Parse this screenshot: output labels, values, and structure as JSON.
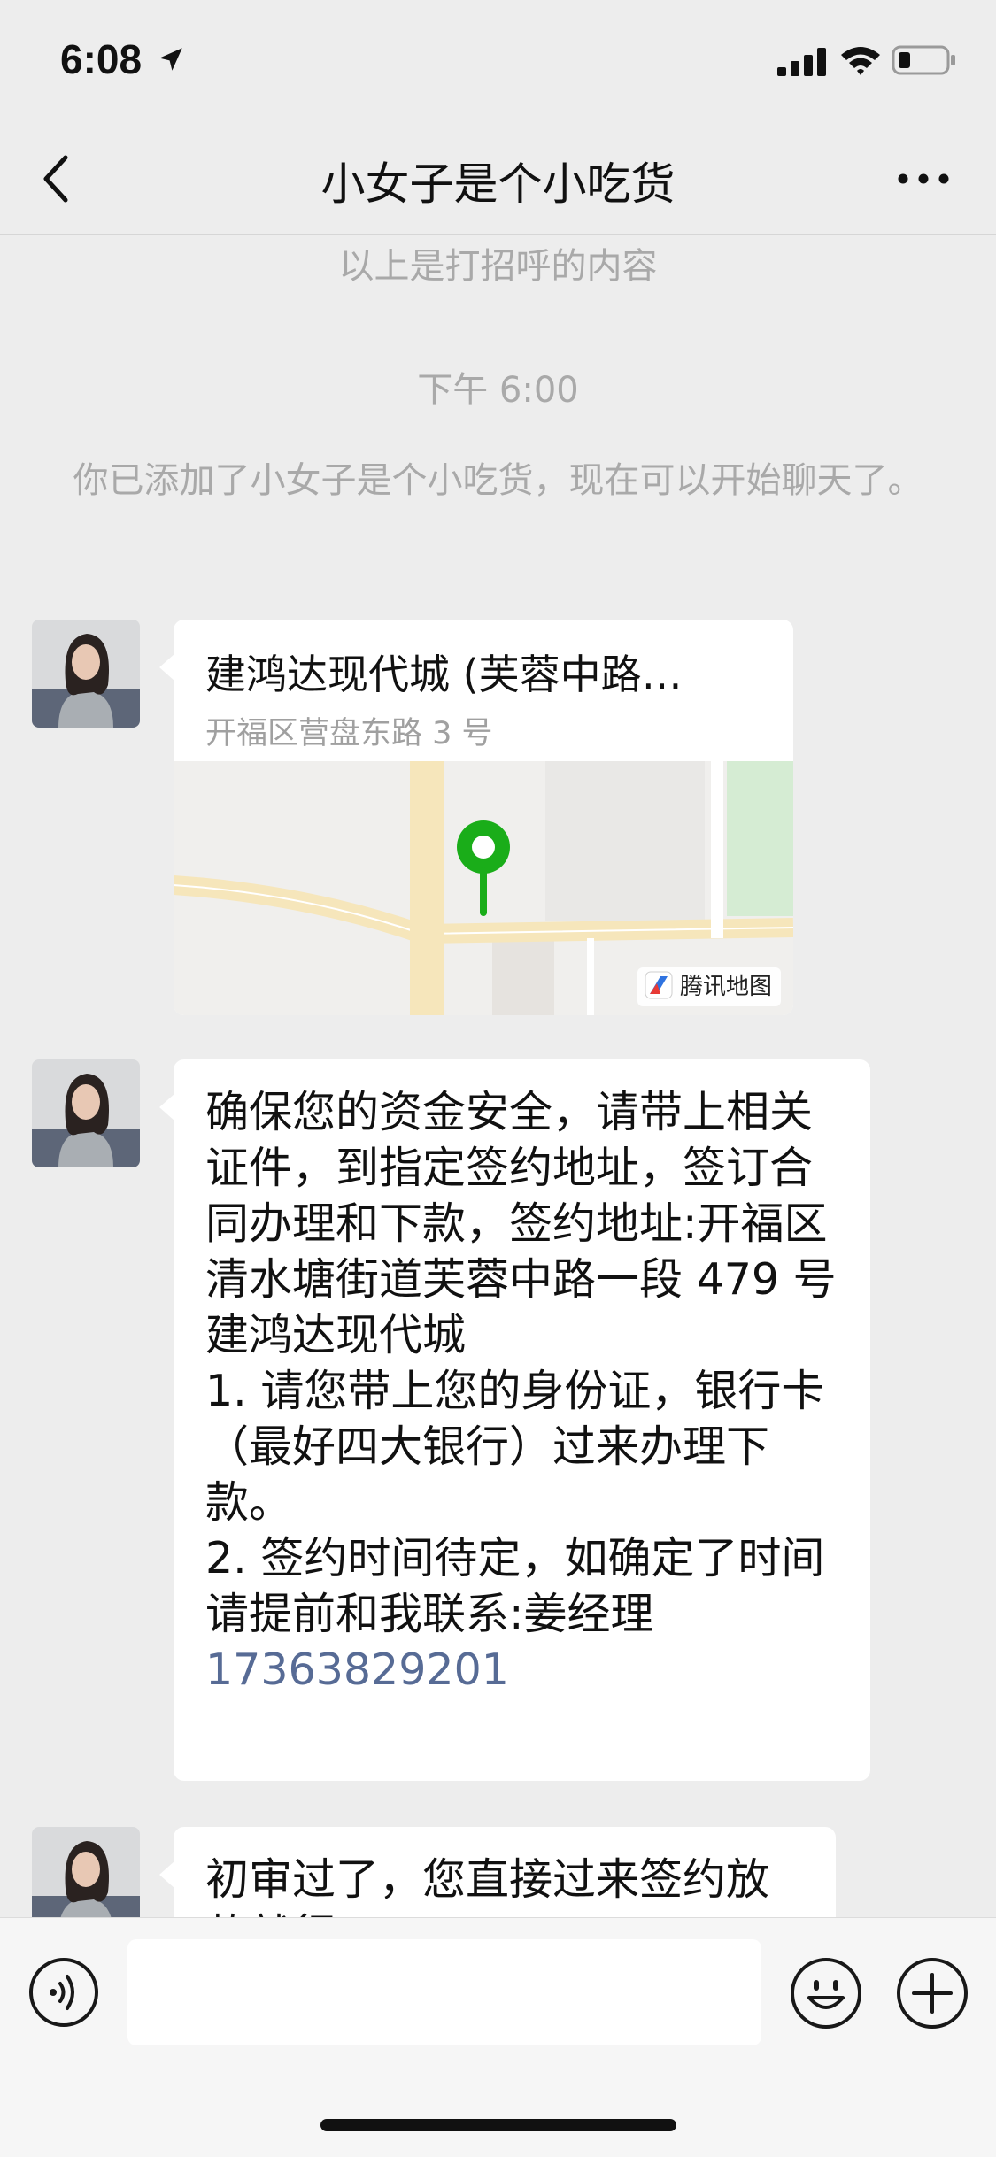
{
  "status_bar": {
    "time": "6:08"
  },
  "nav": {
    "title": "小女子是个小吃货"
  },
  "system_messages": {
    "greeting_note": "以上是打招呼的内容",
    "timestamp": "下午 6:00",
    "added_note": "你已添加了小女子是个小吃货，现在可以开始聊天了。"
  },
  "messages": [
    {
      "type": "location",
      "title": "建鸿达现代城 (芙蓉中路…",
      "address": "开福区营盘东路 3 号",
      "map_provider": "腾讯地图"
    },
    {
      "type": "text",
      "body": "确保您的资金安全，请带上相关证件，到指定签约地址，签订合同办理和下款，签约地址:开福区清水塘街道芙蓉中路一段 479 号建鸿达现代城\n1. 请您带上您的身份证，银行卡（最好四大银行）过来办理下款。\n2. 签约时间待定，如确定了时间请提前和我联系:姜经理\n",
      "phone": "17363829201"
    },
    {
      "type": "text",
      "body": "初审过了，您直接过来签约放款就行"
    }
  ],
  "colors": {
    "link": "#576b95",
    "map_pin": "#1aad19",
    "background": "#ededed"
  },
  "icons": [
    "back-icon",
    "more-icon",
    "voice-icon",
    "emoji-icon",
    "plus-icon"
  ]
}
